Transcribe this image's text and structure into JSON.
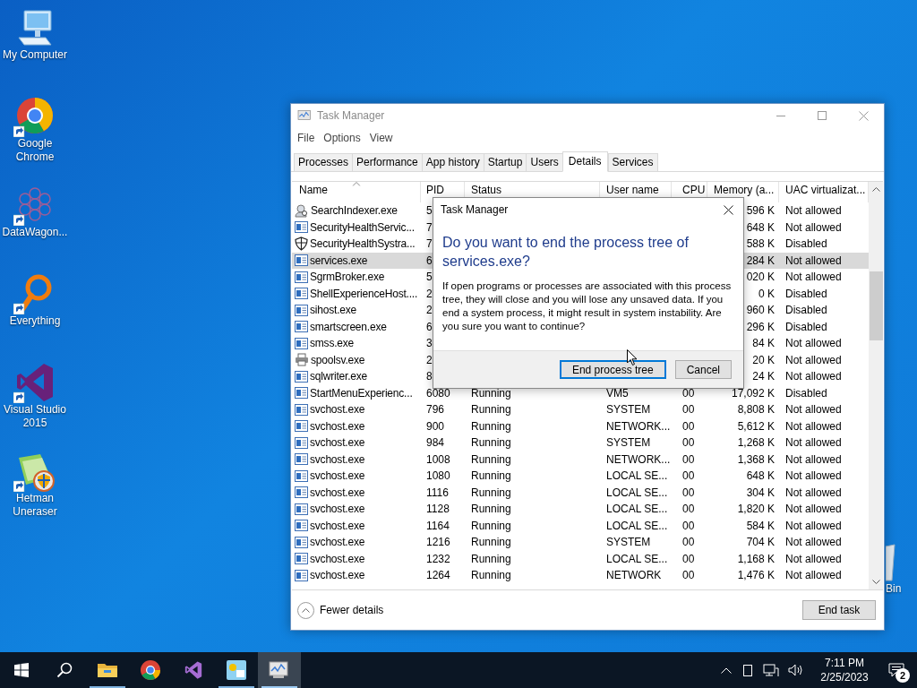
{
  "desktop_icons": [
    {
      "label": "My Computer",
      "kind": "computer",
      "shortcut": false
    },
    {
      "label": "Google Chrome",
      "kind": "chrome",
      "shortcut": true
    },
    {
      "label": "DataWagon...",
      "kind": "datawagon",
      "shortcut": true
    },
    {
      "label": "Everything",
      "kind": "everything",
      "shortcut": true
    },
    {
      "label": "Visual Studio 2015",
      "kind": "visualstudio",
      "shortcut": true
    },
    {
      "label": "Hetman Uneraser",
      "kind": "hetman",
      "shortcut": true
    }
  ],
  "recycle_bin": {
    "label": "Bin"
  },
  "window": {
    "title": "Task Manager",
    "active": false
  },
  "menu": [
    "File",
    "Options",
    "View"
  ],
  "tabs": [
    {
      "label": "Processes",
      "selected": false
    },
    {
      "label": "Performance",
      "selected": false
    },
    {
      "label": "App history",
      "selected": false
    },
    {
      "label": "Startup",
      "selected": false
    },
    {
      "label": "Users",
      "selected": false
    },
    {
      "label": "Details",
      "selected": true
    },
    {
      "label": "Services",
      "selected": false
    }
  ],
  "table": {
    "columns": [
      {
        "label": "Name",
        "sorted": true
      },
      {
        "label": "PID",
        "sorted": false
      },
      {
        "label": "Status",
        "sorted": false
      },
      {
        "label": "User name",
        "sorted": false
      },
      {
        "label": "CPU",
        "sorted": false
      },
      {
        "label": "Memory (a...",
        "sorted": false
      },
      {
        "label": "UAC virtualizat...",
        "sorted": false
      }
    ],
    "rows": [
      {
        "kind": "search",
        "name": "SearchIndexer.exe",
        "pid": "5",
        "memory": "596 K",
        "uac": "Not allowed",
        "selected": false
      },
      {
        "kind": "app",
        "name": "SecurityHealthServic...",
        "pid": "7",
        "memory": "648 K",
        "uac": "Not allowed",
        "selected": false
      },
      {
        "kind": "shield",
        "name": "SecurityHealthSystra...",
        "pid": "7",
        "memory": "588 K",
        "uac": "Disabled",
        "selected": false
      },
      {
        "kind": "app",
        "name": "services.exe",
        "pid": "6",
        "memory": "284 K",
        "uac": "Not allowed",
        "selected": true
      },
      {
        "kind": "app",
        "name": "SgrmBroker.exe",
        "pid": "5",
        "memory": "020 K",
        "uac": "Not allowed",
        "selected": false
      },
      {
        "kind": "app",
        "name": "ShellExperienceHost....",
        "pid": "2",
        "memory": "0 K",
        "uac": "Disabled",
        "selected": false
      },
      {
        "kind": "app",
        "name": "sihost.exe",
        "pid": "2",
        "memory": "960 K",
        "uac": "Disabled",
        "selected": false
      },
      {
        "kind": "app",
        "name": "smartscreen.exe",
        "pid": "6",
        "memory": "296 K",
        "uac": "Disabled",
        "selected": false
      },
      {
        "kind": "app",
        "name": "smss.exe",
        "pid": "3",
        "memory": "84 K",
        "uac": "Not allowed",
        "selected": false
      },
      {
        "kind": "printer",
        "name": "spoolsv.exe",
        "pid": "2",
        "memory": "20 K",
        "uac": "Not allowed",
        "selected": false
      },
      {
        "kind": "app",
        "name": "sqlwriter.exe",
        "pid": "8",
        "memory": "24 K",
        "uac": "Not allowed",
        "selected": false
      },
      {
        "kind": "app",
        "name": "StartMenuExperienc...",
        "pid": "6080",
        "status": "Running",
        "user": "VM5",
        "cpu": "00",
        "memory": "17,092 K",
        "uac": "Disabled",
        "selected": false
      },
      {
        "kind": "app",
        "name": "svchost.exe",
        "pid": "796",
        "status": "Running",
        "user": "SYSTEM",
        "cpu": "00",
        "memory": "8,808 K",
        "uac": "Not allowed",
        "selected": false
      },
      {
        "kind": "app",
        "name": "svchost.exe",
        "pid": "900",
        "status": "Running",
        "user": "NETWORK...",
        "cpu": "00",
        "memory": "5,612 K",
        "uac": "Not allowed",
        "selected": false
      },
      {
        "kind": "app",
        "name": "svchost.exe",
        "pid": "984",
        "status": "Running",
        "user": "SYSTEM",
        "cpu": "00",
        "memory": "1,268 K",
        "uac": "Not allowed",
        "selected": false
      },
      {
        "kind": "app",
        "name": "svchost.exe",
        "pid": "1008",
        "status": "Running",
        "user": "NETWORK...",
        "cpu": "00",
        "memory": "1,368 K",
        "uac": "Not allowed",
        "selected": false
      },
      {
        "kind": "app",
        "name": "svchost.exe",
        "pid": "1080",
        "status": "Running",
        "user": "LOCAL SE...",
        "cpu": "00",
        "memory": "648 K",
        "uac": "Not allowed",
        "selected": false
      },
      {
        "kind": "app",
        "name": "svchost.exe",
        "pid": "1116",
        "status": "Running",
        "user": "LOCAL SE...",
        "cpu": "00",
        "memory": "304 K",
        "uac": "Not allowed",
        "selected": false
      },
      {
        "kind": "app",
        "name": "svchost.exe",
        "pid": "1128",
        "status": "Running",
        "user": "LOCAL SE...",
        "cpu": "00",
        "memory": "1,820 K",
        "uac": "Not allowed",
        "selected": false
      },
      {
        "kind": "app",
        "name": "svchost.exe",
        "pid": "1164",
        "status": "Running",
        "user": "LOCAL SE...",
        "cpu": "00",
        "memory": "584 K",
        "uac": "Not allowed",
        "selected": false
      },
      {
        "kind": "app",
        "name": "svchost.exe",
        "pid": "1216",
        "status": "Running",
        "user": "SYSTEM",
        "cpu": "00",
        "memory": "704 K",
        "uac": "Not allowed",
        "selected": false
      },
      {
        "kind": "app",
        "name": "svchost.exe",
        "pid": "1232",
        "status": "Running",
        "user": "LOCAL SE...",
        "cpu": "00",
        "memory": "1,168 K",
        "uac": "Not allowed",
        "selected": false
      },
      {
        "kind": "app",
        "name": "svchost.exe",
        "pid": "1264",
        "status": "Running",
        "user": "NETWORK",
        "cpu": "00",
        "memory": "1,476 K",
        "uac": "Not allowed",
        "selected": false
      }
    ]
  },
  "footer": {
    "details_toggle": "Fewer details",
    "end_task": "End task"
  },
  "dialog": {
    "title": "Task Manager",
    "heading": "Do you want to end the process tree of services.exe?",
    "message": "If open programs or processes are associated with this process tree, they will close and you will lose any unsaved data. If you end a system process, it might result in system instability. Are you sure you want to continue?",
    "buttons": [
      {
        "label": "End process tree",
        "focused": true
      },
      {
        "label": "Cancel",
        "focused": false
      }
    ]
  },
  "taskbar": {
    "items": [
      {
        "kind": "start",
        "running": false,
        "active": false
      },
      {
        "kind": "search",
        "running": false,
        "active": false
      },
      {
        "kind": "explorer",
        "running": true,
        "active": false
      },
      {
        "kind": "chrome",
        "running": false,
        "active": false
      },
      {
        "kind": "visualstudio",
        "running": false,
        "active": false
      },
      {
        "kind": "hetman",
        "running": true,
        "active": false
      },
      {
        "kind": "taskmanager",
        "running": true,
        "active": true
      }
    ],
    "time": "7:11 PM",
    "date": "2/25/2023",
    "notifications": "2"
  }
}
